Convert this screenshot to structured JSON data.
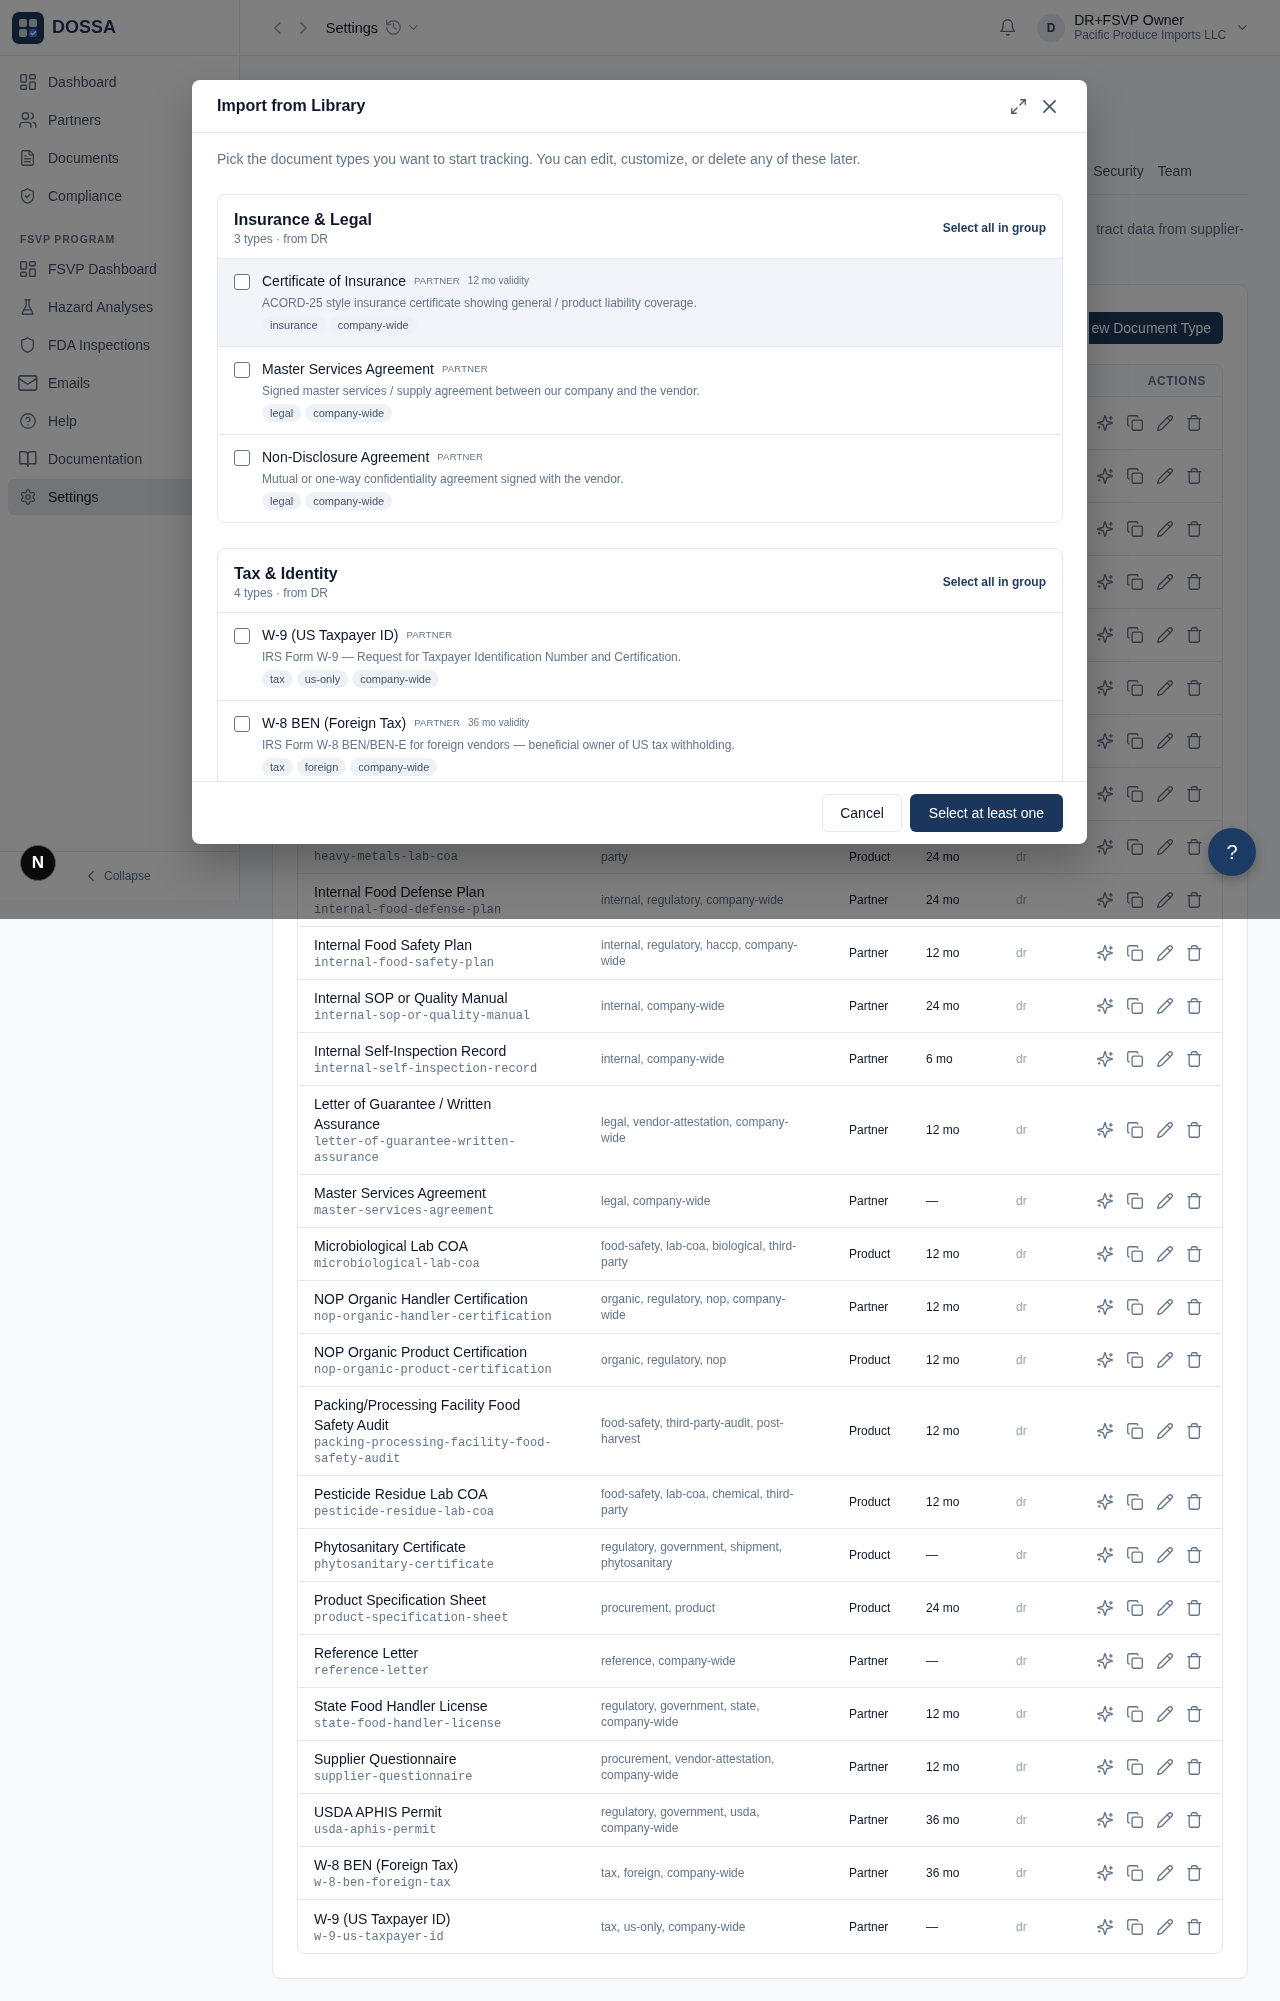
{
  "header": {
    "breadcrumb": "Settings",
    "user": {
      "initial": "D",
      "name": "DR+FSVP Owner",
      "org": "Pacific Produce Imports LLC"
    }
  },
  "sidebar": {
    "brand": "DOSSA",
    "sections": [
      {
        "items": [
          {
            "label": "Dashboard",
            "selected": false
          },
          {
            "label": "Partners",
            "selected": false
          },
          {
            "label": "Documents",
            "selected": false
          },
          {
            "label": "Compliance",
            "selected": false
          }
        ]
      },
      {
        "label": "FSVP PROGRAM",
        "items": [
          {
            "label": "FSVP Dashboard",
            "selected": false
          },
          {
            "label": "Hazard Analyses",
            "selected": false
          },
          {
            "label": "FDA Inspections",
            "selected": false
          },
          {
            "label": "Emails",
            "selected": false
          },
          {
            "label": "Help",
            "selected": false
          },
          {
            "label": "Documentation",
            "selected": false
          },
          {
            "label": "Settings",
            "selected": true
          }
        ]
      }
    ],
    "collapse": "Collapse"
  },
  "page": {
    "tabs": [
      {
        "label": "Security",
        "selected": false
      },
      {
        "label": "Team",
        "selected": false
      }
    ],
    "intro": "tract data from supplier-",
    "new_button": "ew Document Type",
    "table": {
      "actions_header": "ACTIONS",
      "rows": [
        {
          "kind": "covered"
        },
        {
          "kind": "covered"
        },
        {
          "kind": "covered"
        },
        {
          "kind": "covered"
        },
        {
          "kind": "covered"
        },
        {
          "kind": "covered"
        },
        {
          "kind": "covered"
        },
        {
          "kind": "covered"
        },
        {
          "kind": "cut",
          "slug": "heavy-metals-lab-coa",
          "tags": "party",
          "scope": "Product",
          "validity": "24 mo",
          "source": "dr"
        },
        {
          "kind": "full",
          "name": "Internal Food Defense Plan",
          "slug": "internal-food-defense-plan",
          "tags": "internal, regulatory, company-wide",
          "scope": "Partner",
          "validity": "24 mo",
          "source": "dr"
        },
        {
          "kind": "full",
          "name": "Internal Food Safety Plan",
          "slug": "internal-food-safety-plan",
          "tags": "internal, regulatory, haccp, company-wide",
          "scope": "Partner",
          "validity": "12 mo",
          "source": "dr"
        },
        {
          "kind": "full",
          "name": "Internal SOP or Quality Manual",
          "slug": "internal-sop-or-quality-manual",
          "tags": "internal, company-wide",
          "scope": "Partner",
          "validity": "24 mo",
          "source": "dr"
        },
        {
          "kind": "full",
          "name": "Internal Self-Inspection Record",
          "slug": "internal-self-inspection-record",
          "tags": "internal, company-wide",
          "scope": "Partner",
          "validity": "6 mo",
          "source": "dr"
        },
        {
          "kind": "full",
          "name": "Letter of Guarantee / Written Assurance",
          "slug": "letter-of-guarantee-written-assurance",
          "tags": "legal, vendor-attestation, company-wide",
          "scope": "Partner",
          "validity": "12 mo",
          "source": "dr"
        },
        {
          "kind": "full",
          "name": "Master Services Agreement",
          "slug": "master-services-agreement",
          "tags": "legal, company-wide",
          "scope": "Partner",
          "validity": "—",
          "source": "dr"
        },
        {
          "kind": "full",
          "name": "Microbiological Lab COA",
          "slug": "microbiological-lab-coa",
          "tags": "food-safety, lab-coa, biological, third-party",
          "scope": "Product",
          "validity": "12 mo",
          "source": "dr"
        },
        {
          "kind": "full",
          "name": "NOP Organic Handler Certification",
          "slug": "nop-organic-handler-certification",
          "tags": "organic, regulatory, nop, company-wide",
          "scope": "Partner",
          "validity": "12 mo",
          "source": "dr"
        },
        {
          "kind": "full",
          "name": "NOP Organic Product Certification",
          "slug": "nop-organic-product-certification",
          "tags": "organic, regulatory, nop",
          "scope": "Product",
          "validity": "12 mo",
          "source": "dr"
        },
        {
          "kind": "full",
          "name": "Packing/Processing Facility Food Safety Audit",
          "slug": "packing-processing-facility-food-safety-audit",
          "tags": "food-safety, third-party-audit, post-harvest",
          "scope": "Product",
          "validity": "12 mo",
          "source": "dr"
        },
        {
          "kind": "full",
          "name": "Pesticide Residue Lab COA",
          "slug": "pesticide-residue-lab-coa",
          "tags": "food-safety, lab-coa, chemical, third-party",
          "scope": "Product",
          "validity": "12 mo",
          "source": "dr"
        },
        {
          "kind": "full",
          "name": "Phytosanitary Certificate",
          "slug": "phytosanitary-certificate",
          "tags": "regulatory, government, shipment, phytosanitary",
          "scope": "Product",
          "validity": "—",
          "source": "dr"
        },
        {
          "kind": "full",
          "name": "Product Specification Sheet",
          "slug": "product-specification-sheet",
          "tags": "procurement, product",
          "scope": "Product",
          "validity": "24 mo",
          "source": "dr"
        },
        {
          "kind": "full",
          "name": "Reference Letter",
          "slug": "reference-letter",
          "tags": "reference, company-wide",
          "scope": "Partner",
          "validity": "—",
          "source": "dr"
        },
        {
          "kind": "full",
          "name": "State Food Handler License",
          "slug": "state-food-handler-license",
          "tags": "regulatory, government, state, company-wide",
          "scope": "Partner",
          "validity": "12 mo",
          "source": "dr"
        },
        {
          "kind": "full",
          "name": "Supplier Questionnaire",
          "slug": "supplier-questionnaire",
          "tags": "procurement, vendor-attestation, company-wide",
          "scope": "Partner",
          "validity": "12 mo",
          "source": "dr"
        },
        {
          "kind": "full",
          "name": "USDA APHIS Permit",
          "slug": "usda-aphis-permit",
          "tags": "regulatory, government, usda, company-wide",
          "scope": "Partner",
          "validity": "36 mo",
          "source": "dr"
        },
        {
          "kind": "full",
          "name": "W-8 BEN (Foreign Tax)",
          "slug": "w-8-ben-foreign-tax",
          "tags": "tax, foreign, company-wide",
          "scope": "Partner",
          "validity": "36 mo",
          "source": "dr"
        },
        {
          "kind": "full",
          "name": "W-9 (US Taxpayer ID)",
          "slug": "w-9-us-taxpayer-id",
          "tags": "tax, us-only, company-wide",
          "scope": "Partner",
          "validity": "—",
          "source": "dr"
        }
      ]
    }
  },
  "modal": {
    "title": "Import from Library",
    "intro": "Pick the document types you want to start tracking. You can edit, customize, or delete any of these later.",
    "groups": [
      {
        "title": "Insurance & Legal",
        "meta": "3 types · from DR",
        "select_all": "Select all in group",
        "items": [
          {
            "name": "Certificate of Insurance",
            "scope": "PARTNER",
            "validity": "12 mo validity",
            "description": "ACORD-25 style insurance certificate showing general / product liability coverage.",
            "tags": [
              "insurance",
              "company-wide"
            ],
            "checked": false,
            "hovered": true
          },
          {
            "name": "Master Services Agreement",
            "scope": "PARTNER",
            "description": "Signed master services / supply agreement between our company and the vendor.",
            "tags": [
              "legal",
              "company-wide"
            ],
            "checked": false,
            "hovered": false
          },
          {
            "name": "Non-Disclosure Agreement",
            "scope": "PARTNER",
            "description": "Mutual or one-way confidentiality agreement signed with the vendor.",
            "tags": [
              "legal",
              "company-wide"
            ],
            "checked": false,
            "hovered": false
          }
        ]
      },
      {
        "title": "Tax & Identity",
        "meta": "4 types · from DR",
        "select_all": "Select all in group",
        "items": [
          {
            "name": "W-9 (US Taxpayer ID)",
            "scope": "PARTNER",
            "description": "IRS Form W-9 — Request for Taxpayer Identification Number and Certification.",
            "tags": [
              "tax",
              "us-only",
              "company-wide"
            ],
            "checked": false,
            "hovered": false
          },
          {
            "name": "W-8 BEN (Foreign Tax)",
            "scope": "PARTNER",
            "validity": "36 mo validity",
            "description": "IRS Form W-8 BEN/BEN-E for foreign vendors — beneficial owner of US tax withholding.",
            "tags": [
              "tax",
              "foreign",
              "company-wide"
            ],
            "checked": false,
            "hovered": false
          }
        ]
      }
    ],
    "cancel": "Cancel",
    "confirm": "Select at least one"
  },
  "help_button": "?",
  "dev_badge": "N"
}
